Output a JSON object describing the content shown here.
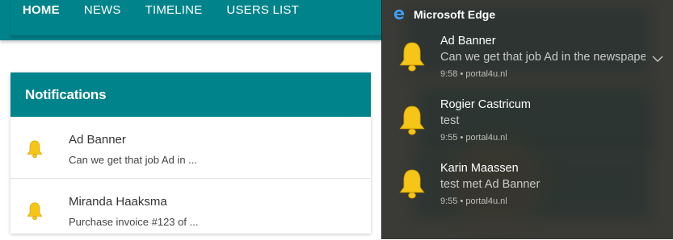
{
  "nav": {
    "items": [
      {
        "label": "HOME"
      },
      {
        "label": "NEWS"
      },
      {
        "label": "TIMELINE"
      },
      {
        "label": "USERS LIST"
      }
    ]
  },
  "notifications_card": {
    "title": "Notifications",
    "items": [
      {
        "title": "Ad Banner",
        "text": "Can we get that job Ad in ...",
        "icon": "bell-icon"
      },
      {
        "title": "Miranda Haaksma",
        "text": "Purchase invoice #123 of ...",
        "icon": "bell-icon"
      }
    ]
  },
  "edge_panel": {
    "app_name": "Microsoft Edge",
    "app_icon": "edge-logo-icon",
    "toasts": [
      {
        "title": "Ad Banner",
        "body": "Can we get that job Ad in the newspaper",
        "meta": "9:58 • portal4u.nl",
        "icon": "bell-icon"
      },
      {
        "title": "Rogier Castricum",
        "body": "test",
        "meta": "9:55 • portal4u.nl",
        "icon": "bell-icon"
      },
      {
        "title": "Karin Maassen",
        "body": "test met Ad Banner",
        "meta": "9:55 • portal4u.nl",
        "icon": "bell-icon"
      }
    ]
  },
  "colors": {
    "brand_teal": "#00838a",
    "bell_yellow": "#f5c518",
    "panel_bg": "#3a3a36"
  }
}
